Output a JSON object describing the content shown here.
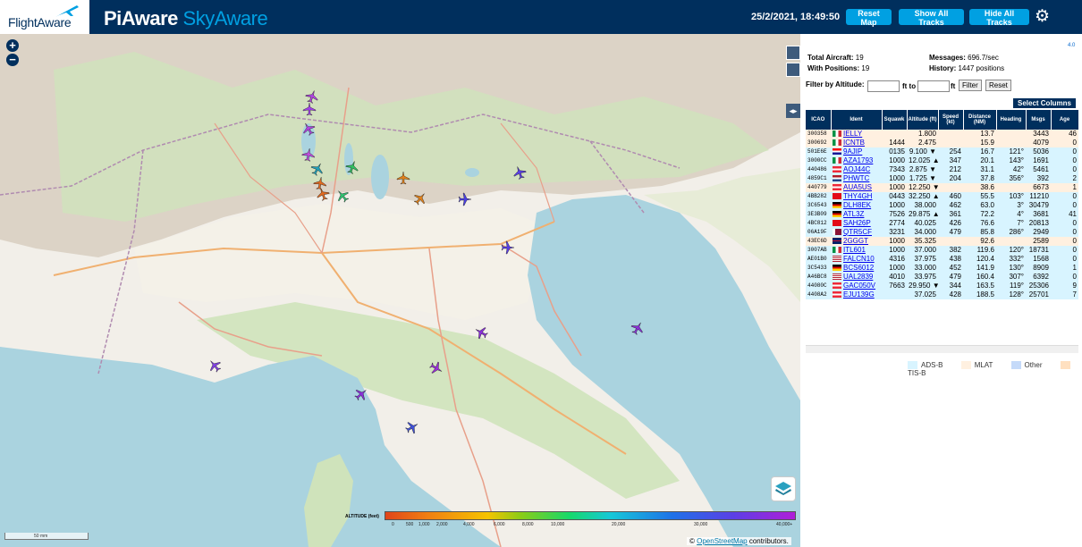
{
  "header": {
    "logo": "FlightAware",
    "title_main": "PiAware ",
    "title_accent": "SkyAware",
    "datetime": "25/2/2021, 18:49:50",
    "reset_map": "Reset Map",
    "show_all_tracks": "Show All Tracks",
    "hide_all_tracks": "Hide All Tracks",
    "settings_icon": "gear-icon"
  },
  "map": {
    "zoom_in": "+",
    "zoom_out": "−",
    "scale": "50 mm",
    "attribution_link": "OpenStreetMap",
    "attribution_suffix": " contributors.",
    "altitude_legend": {
      "title": "ALTITUDE (feet)",
      "ticks": [
        "0",
        "500",
        "1,000",
        "2,000",
        "4,000",
        "6,000",
        "8,000",
        "10,000",
        "20,000",
        "30,000",
        "40,000+"
      ]
    },
    "colors": {
      "water": "#aad3df",
      "land": "#f2efe9",
      "forest": "#c8e0b0",
      "mountain": "#d9d0c9",
      "road": "#e8a08a",
      "motorway": "#f0b070"
    }
  },
  "stats": {
    "total_label": "Total Aircraft:",
    "total": "19",
    "positions_label": "With Positions:",
    "positions": "19",
    "messages_label": "Messages:",
    "messages": "696.7/sec",
    "history_label": "History:",
    "history": "1447 positions",
    "version": "4.0"
  },
  "filter": {
    "label": "Filter by Altitude:",
    "to": "ft to",
    "ft": "ft",
    "filter_btn": "Filter",
    "reset_btn": "Reset"
  },
  "select_columns": "Select Columns",
  "table": {
    "columns": [
      "ICAO",
      "Ident",
      "Squawk",
      "Altitude (ft)",
      "Speed (kt)",
      "Distance (NM)",
      "Heading",
      "Msgs",
      "Age"
    ],
    "rows": [
      {
        "icao": "300358",
        "flag": "it",
        "ident": "IELLY",
        "squawk": "",
        "alt": "1.800",
        "speed": "",
        "dist": "13.7",
        "hdg": "",
        "msgs": "3443",
        "age": "46",
        "type": "mlat"
      },
      {
        "icao": "300692",
        "flag": "it",
        "ident": "ICNTB",
        "squawk": "1444",
        "alt": "2.475",
        "speed": "",
        "dist": "15.9",
        "hdg": "",
        "msgs": "4079",
        "age": "0",
        "type": "mlat"
      },
      {
        "icao": "501E6E",
        "flag": "hr",
        "ident": "9AJIP",
        "squawk": "0135",
        "alt": "9.100 ▼",
        "speed": "254",
        "dist": "16.7",
        "hdg": "121°",
        "msgs": "5036",
        "age": "0",
        "type": "adsb"
      },
      {
        "icao": "3000CC",
        "flag": "it",
        "ident": "AZA1793",
        "squawk": "1000",
        "alt": "12.025 ▲",
        "speed": "347",
        "dist": "20.1",
        "hdg": "143°",
        "msgs": "1691",
        "age": "0",
        "type": "adsb"
      },
      {
        "icao": "440486",
        "flag": "at",
        "ident": "AOJ44C",
        "squawk": "7343",
        "alt": "2.875 ▼",
        "speed": "212",
        "dist": "31.1",
        "hdg": "42°",
        "msgs": "5461",
        "age": "0",
        "type": "adsb"
      },
      {
        "icao": "4859C1",
        "flag": "nl",
        "ident": "PHWTC",
        "squawk": "1000",
        "alt": "1.725 ▼",
        "speed": "204",
        "dist": "37.8",
        "hdg": "356°",
        "msgs": "392",
        "age": "2",
        "type": "adsb"
      },
      {
        "icao": "440779",
        "flag": "at",
        "ident": "AUA5US",
        "squawk": "1000",
        "alt": "12.250 ▼",
        "speed": "",
        "dist": "38.6",
        "hdg": "",
        "msgs": "6673",
        "age": "1",
        "type": "mlat"
      },
      {
        "icao": "4BB282",
        "flag": "tr",
        "ident": "THY4GH",
        "squawk": "0443",
        "alt": "32.250 ▲",
        "speed": "460",
        "dist": "55.5",
        "hdg": "103°",
        "msgs": "11210",
        "age": "0",
        "type": "adsb"
      },
      {
        "icao": "3C6543",
        "flag": "de",
        "ident": "DLH8EK",
        "squawk": "1000",
        "alt": "38.000",
        "speed": "462",
        "dist": "63.0",
        "hdg": "3°",
        "msgs": "30479",
        "age": "0",
        "type": "adsb"
      },
      {
        "icao": "3E3B09",
        "flag": "de",
        "ident": "ATL3Z",
        "squawk": "7526",
        "alt": "29.875 ▲",
        "speed": "361",
        "dist": "72.2",
        "hdg": "4°",
        "msgs": "3681",
        "age": "41",
        "type": "adsb"
      },
      {
        "icao": "4BC812",
        "flag": "tr",
        "ident": "SAH26P",
        "squawk": "2774",
        "alt": "40.025",
        "speed": "426",
        "dist": "76.6",
        "hdg": "7°",
        "msgs": "20813",
        "age": "0",
        "type": "adsb"
      },
      {
        "icao": "06A19F",
        "flag": "qa",
        "ident": "QTR5CF",
        "squawk": "3231",
        "alt": "34.000",
        "speed": "479",
        "dist": "85.8",
        "hdg": "286°",
        "msgs": "2949",
        "age": "0",
        "type": "adsb"
      },
      {
        "icao": "43EC6D",
        "flag": "gb",
        "ident": "2GGGT",
        "squawk": "1000",
        "alt": "35.325",
        "speed": "",
        "dist": "92.6",
        "hdg": "",
        "msgs": "2589",
        "age": "0",
        "type": "mlat"
      },
      {
        "icao": "3007AB",
        "flag": "it",
        "ident": "ITL601",
        "squawk": "1000",
        "alt": "37.000",
        "speed": "382",
        "dist": "119.6",
        "hdg": "120°",
        "msgs": "18731",
        "age": "0",
        "type": "adsb"
      },
      {
        "icao": "AE01B0",
        "flag": "us",
        "ident": "FALCN10",
        "squawk": "4316",
        "alt": "37.975",
        "speed": "438",
        "dist": "120.4",
        "hdg": "332°",
        "msgs": "1568",
        "age": "0",
        "type": "adsb"
      },
      {
        "icao": "3C5433",
        "flag": "de",
        "ident": "BCS6012",
        "squawk": "1000",
        "alt": "33.000",
        "speed": "452",
        "dist": "141.9",
        "hdg": "130°",
        "msgs": "8909",
        "age": "1",
        "type": "adsb"
      },
      {
        "icao": "A46BC8",
        "flag": "us",
        "ident": "UAL2839",
        "squawk": "4010",
        "alt": "33.975",
        "speed": "479",
        "dist": "160.4",
        "hdg": "307°",
        "msgs": "6392",
        "age": "0",
        "type": "adsb"
      },
      {
        "icao": "44080C",
        "flag": "at",
        "ident": "GAC050V",
        "squawk": "7663",
        "alt": "29.950 ▼",
        "speed": "344",
        "dist": "163.5",
        "hdg": "119°",
        "msgs": "25306",
        "age": "9",
        "type": "adsb"
      },
      {
        "icao": "4408A2",
        "flag": "at",
        "ident": "EJU139G",
        "squawk": "",
        "alt": "37.025",
        "speed": "428",
        "dist": "188.5",
        "hdg": "128°",
        "msgs": "25701",
        "age": "7",
        "type": "adsb"
      }
    ]
  },
  "legend": {
    "adsb": "ADS-B",
    "mlat": "MLAT",
    "other": "Other",
    "tisb": "TIS-B",
    "colors": {
      "adsb": "#d8f4ff",
      "mlat": "#fff0e0",
      "other": "#c5daf9",
      "tisb": "#ffe0c0"
    }
  },
  "aircraft_markers": [
    {
      "name": "marker-aircraft",
      "color": "#b043e0",
      "rot": 20
    },
    {
      "name": "marker-aircraft",
      "color": "#a040e8",
      "rot": 0
    },
    {
      "name": "marker-aircraft",
      "color": "#b043e0",
      "rot": -30
    },
    {
      "name": "marker-aircraft",
      "color": "#c04de0",
      "rot": 10
    },
    {
      "name": "marker-aircraft",
      "color": "#22a0b8",
      "rot": 30
    },
    {
      "name": "marker-aircraft",
      "color": "#30c060",
      "rot": 20
    },
    {
      "name": "marker-aircraft",
      "color": "#e06a20",
      "rot": -20
    },
    {
      "name": "marker-aircraft",
      "color": "#e06a20",
      "rot": 10
    },
    {
      "name": "marker-aircraft",
      "color": "#30c070",
      "rot": -40
    },
    {
      "name": "marker-aircraft",
      "color": "#e0801a",
      "rot": 0
    },
    {
      "name": "marker-aircraft",
      "color": "#e0801a",
      "rot": 40
    },
    {
      "name": "marker-aircraft",
      "color": "#5a3ee6",
      "rot": -20
    },
    {
      "name": "marker-aircraft",
      "color": "#4a3fe0",
      "rot": 90
    },
    {
      "name": "marker-aircraft",
      "color": "#5a3ee6",
      "rot": 90
    },
    {
      "name": "marker-aircraft",
      "color": "#8a30d8",
      "rot": 30
    },
    {
      "name": "marker-aircraft",
      "color": "#8a30d8",
      "rot": -60
    },
    {
      "name": "marker-aircraft",
      "color": "#9a30d8",
      "rot": 120
    },
    {
      "name": "marker-aircraft",
      "color": "#8040e0",
      "rot": -40
    },
    {
      "name": "marker-aircraft",
      "color": "#8a30d8",
      "rot": 50
    },
    {
      "name": "marker-aircraft",
      "color": "#4050d8",
      "rot": 60
    }
  ]
}
